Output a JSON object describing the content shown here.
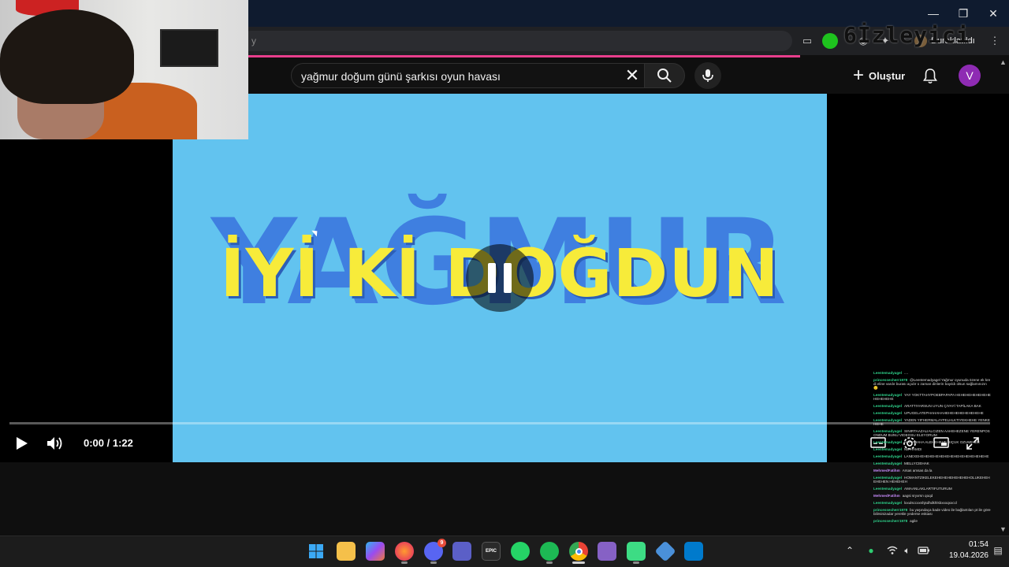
{
  "window": {
    "controls": {
      "minimize": "—",
      "maximize": "❐",
      "close": "✕"
    }
  },
  "browser": {
    "address_partial": "y",
    "watermark": "6İzleyici",
    "profile_label": "Duraklatıldı"
  },
  "youtube": {
    "search_query": "yağmur doğum günü şarkısı oyun havası",
    "create_label": "Oluştur",
    "avatar_letter": "V"
  },
  "video": {
    "background_word": "YAĞMUR",
    "greeting": "İYİ Kİ DOĞDUN",
    "time": "0:00 / 1:22",
    "progress": 0
  },
  "chat": [
    {
      "user": "Leentemadyagel",
      "text": "....",
      "color": "#2ed08a"
    },
    {
      "user": "princessecherr1978",
      "text": "@Leentemadyagel Yağmur oyunuda özene ek kredi eline vardır burası açıdır o zaman dinlerin bayıldı olsun sağlamınızın 🙂",
      "color": "#2ed08a"
    },
    {
      "user": "Leentemadyagel",
      "text": "YAY YOKTTAHYPOEBPAPAPA HEHEHEHEHEHEHEHEHEHEHE",
      "color": "#2ed08a"
    },
    {
      "user": "Leentemadyagel",
      "text": "ARATTIYARSUN UYUN ÇIYAYİ TAPİLAKA BAK",
      "color": "#2ed08a"
    },
    {
      "user": "Leentemadyagel",
      "text": "UPUGELATEPHAHAHAHEHEHEHEHEHEHEHE",
      "color": "#2ed08a"
    },
    {
      "user": "Leentemadyagel",
      "text": "YADEN YIFHERMALAYFELHLKTIYEKHEHE YENKEHEHE",
      "color": "#2ed08a"
    },
    {
      "user": "Leentemadyagel",
      "text": "SINIRTAAZALIALCIZEN AAHEHEZENE YERENPOSONDUM BUNU VIDEOSU ELEYORUM",
      "color": "#2ed08a"
    },
    {
      "user": "Leentemadyagel",
      "text": "HAHAHAHA ALEHEHEHE BIÇUK OZUME IEE",
      "color": "#2ed08a"
    },
    {
      "user": "Leentemadyagel",
      "text": "NE HAMDI",
      "color": "#2ed08a"
    },
    {
      "user": "Leentemadyagel",
      "text": "LANEXEHEHEHEHEHEHEHEHEHEHEHEHEHEHE",
      "color": "#2ed08a"
    },
    {
      "user": "Leentemadyagel",
      "text": "MELLYCIEHAK",
      "color": "#2ed08a"
    },
    {
      "user": "MehmedFatihm",
      "text": "Arsas amsas da la",
      "color": "#c58af9"
    },
    {
      "user": "Leentemadyagel",
      "text": "HOMANTZIKELEKEHEHEHEHEHEHEHOLUKEHEHEHEHEN HEHEHEH",
      "color": "#2ed08a"
    },
    {
      "user": "Leentemadyagel",
      "text": "AMAANLAKLARTIFUTURUM",
      "color": "#2ed08a"
    },
    {
      "user": "MehmedFatihm",
      "text": "aagsi sryxrsn qoqd",
      "color": "#c58af9"
    },
    {
      "user": "Leentemadyagel",
      "text": "lxxulsccxxshjsdhdkhlsbxxxqxxccl",
      "color": "#2ed08a"
    },
    {
      "user": "princessecherr1978",
      "text": "bu yaşındaça bade video ile bağlantıları pt ile görebilirsinizadar yerekle yederse eskiası",
      "color": "#2ed08a"
    },
    {
      "user": "princessecherr1978",
      "text": "agile",
      "color": "#2ed08a"
    }
  ],
  "taskbar": {
    "apps": [
      "windows-start",
      "file-explorer",
      "copilot",
      "firefox",
      "discord",
      "teams",
      "epic-games",
      "whatsapp",
      "spotify",
      "chrome",
      "visual-studio",
      "android-studio",
      "app-grid",
      "vscode"
    ],
    "epic_label": "EPIC",
    "discord_badge": "9",
    "time": "01:54",
    "date": "19.04.2026"
  },
  "colors": {
    "video_bg": "#62c3ef",
    "greeting_yellow": "#f7eb3a",
    "name_blue": "#3f7fe0",
    "avatar_purple": "#8e2bb3",
    "progress_pink": "#e83e8c"
  }
}
